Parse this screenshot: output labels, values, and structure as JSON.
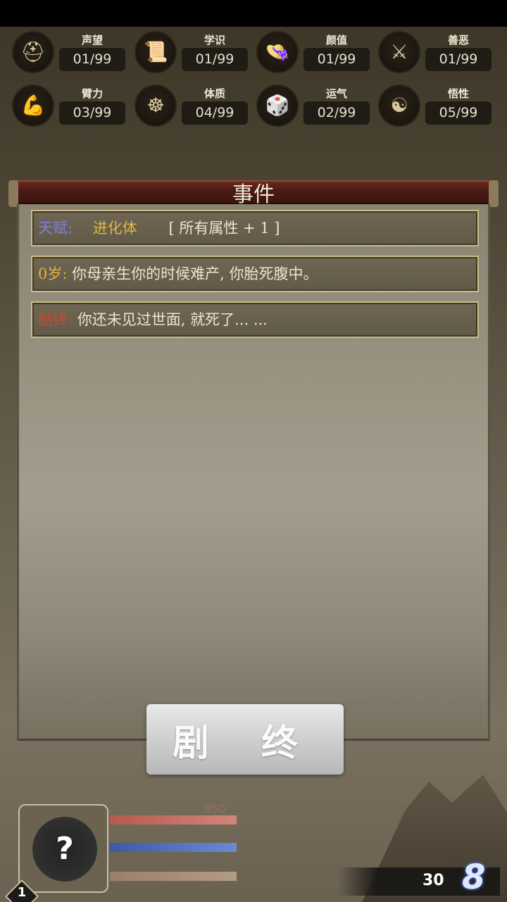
{
  "stats": [
    {
      "name": "声望",
      "value": "01/99",
      "icon": "helmet-icon",
      "glyph": "⛑"
    },
    {
      "name": "学识",
      "value": "01/99",
      "icon": "scroll-icon",
      "glyph": "📜"
    },
    {
      "name": "颜值",
      "value": "01/99",
      "icon": "hat-icon",
      "glyph": "👒"
    },
    {
      "name": "善恶",
      "value": "01/99",
      "icon": "crossed-swords-icon",
      "glyph": "⚔"
    },
    {
      "name": "臂力",
      "value": "03/99",
      "icon": "arm-icon",
      "glyph": "💪"
    },
    {
      "name": "体质",
      "value": "04/99",
      "icon": "meditation-icon",
      "glyph": "☸"
    },
    {
      "name": "运气",
      "value": "02/99",
      "icon": "dice-icon",
      "glyph": "🎲"
    },
    {
      "name": "悟性",
      "value": "05/99",
      "icon": "head-icon",
      "glyph": "☯"
    }
  ],
  "panel": {
    "title": "事件",
    "events": [
      {
        "label": "天赋:",
        "name": "进化体",
        "detail": "[ 所有属性 + 1 ]"
      },
      {
        "label": "0岁:",
        "text": "你母亲生你的时候难产, 你胎死腹中。"
      },
      {
        "label": "剧终:",
        "text": "你还未见过世面, 就死了... ..."
      }
    ]
  },
  "end_button": "剧 终",
  "hud": {
    "avatar_text": "?",
    "level": "1",
    "hp_value": "850",
    "coins": "30",
    "coin_icon": "8"
  },
  "colors": {
    "accent_gold": "#e1b53c",
    "accent_red": "#c8492f",
    "accent_blue": "#7f7fe0"
  }
}
